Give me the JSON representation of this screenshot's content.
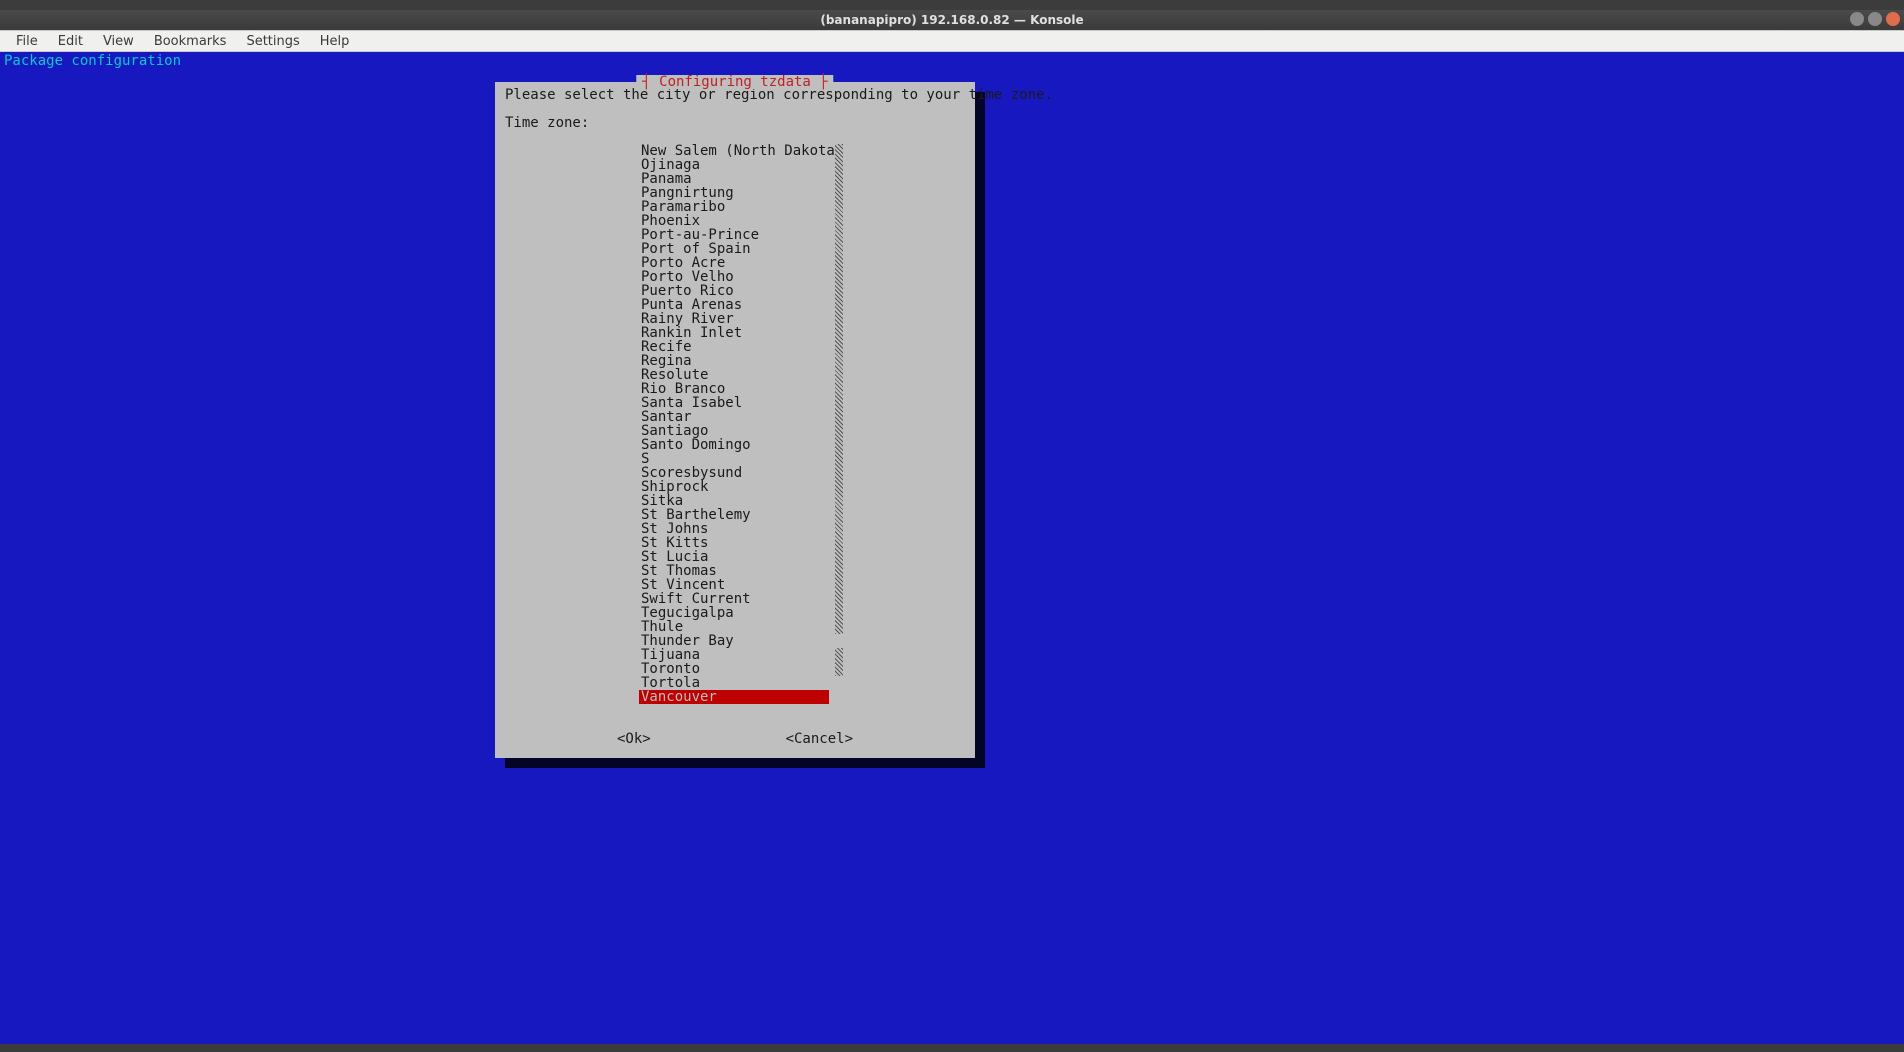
{
  "window": {
    "title": "(bananapipro) 192.168.0.82 — Konsole"
  },
  "menubar": {
    "items": [
      "File",
      "Edit",
      "View",
      "Bookmarks",
      "Settings",
      "Help"
    ]
  },
  "terminal": {
    "header": "Package configuration"
  },
  "dialog": {
    "title": "┤ Configuring tzdata ├",
    "prompt": "Please select the city or region corresponding to your time zone.",
    "subprompt": "Time zone:",
    "selected_index": 39,
    "items": [
      "New Salem (North Dakota)",
      "Ojinaga",
      "Panama",
      "Pangnirtung",
      "Paramaribo",
      "Phoenix",
      "Port-au-Prince",
      "Port of Spain",
      "Porto Acre",
      "Porto Velho",
      "Puerto Rico",
      "Punta Arenas",
      "Rainy River",
      "Rankin Inlet",
      "Recife",
      "Regina",
      "Resolute",
      "Rio Branco",
      "Santa Isabel",
      "Santar",
      "Santiago",
      "Santo Domingo",
      "S",
      "Scoresbysund",
      "Shiprock",
      "Sitka",
      "St Barthelemy",
      "St Johns",
      "St Kitts",
      "St Lucia",
      "St Thomas",
      "St Vincent",
      "Swift Current",
      "Tegucigalpa",
      "Thule",
      "Thunder Bay",
      "Tijuana",
      "Toronto",
      "Tortola",
      "Vancouver"
    ],
    "ok_label": "<Ok>",
    "cancel_label": "<Cancel>"
  }
}
